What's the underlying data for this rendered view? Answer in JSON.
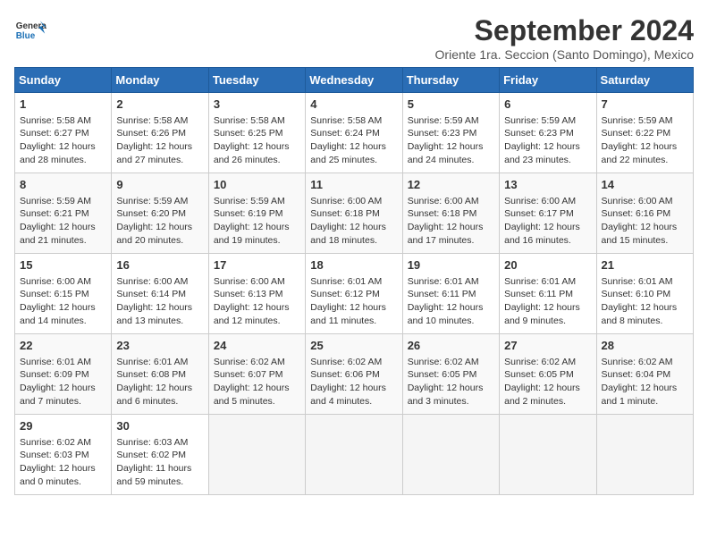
{
  "header": {
    "logo_general": "General",
    "logo_blue": "Blue",
    "month_title": "September 2024",
    "subtitle": "Oriente 1ra. Seccion (Santo Domingo), Mexico"
  },
  "weekdays": [
    "Sunday",
    "Monday",
    "Tuesday",
    "Wednesday",
    "Thursday",
    "Friday",
    "Saturday"
  ],
  "weeks": [
    [
      {
        "day": 1,
        "sunrise": "5:58 AM",
        "sunset": "6:27 PM",
        "daylight": "12 hours and 28 minutes."
      },
      {
        "day": 2,
        "sunrise": "5:58 AM",
        "sunset": "6:26 PM",
        "daylight": "12 hours and 27 minutes."
      },
      {
        "day": 3,
        "sunrise": "5:58 AM",
        "sunset": "6:25 PM",
        "daylight": "12 hours and 26 minutes."
      },
      {
        "day": 4,
        "sunrise": "5:58 AM",
        "sunset": "6:24 PM",
        "daylight": "12 hours and 25 minutes."
      },
      {
        "day": 5,
        "sunrise": "5:59 AM",
        "sunset": "6:23 PM",
        "daylight": "12 hours and 24 minutes."
      },
      {
        "day": 6,
        "sunrise": "5:59 AM",
        "sunset": "6:23 PM",
        "daylight": "12 hours and 23 minutes."
      },
      {
        "day": 7,
        "sunrise": "5:59 AM",
        "sunset": "6:22 PM",
        "daylight": "12 hours and 22 minutes."
      }
    ],
    [
      {
        "day": 8,
        "sunrise": "5:59 AM",
        "sunset": "6:21 PM",
        "daylight": "12 hours and 21 minutes."
      },
      {
        "day": 9,
        "sunrise": "5:59 AM",
        "sunset": "6:20 PM",
        "daylight": "12 hours and 20 minutes."
      },
      {
        "day": 10,
        "sunrise": "5:59 AM",
        "sunset": "6:19 PM",
        "daylight": "12 hours and 19 minutes."
      },
      {
        "day": 11,
        "sunrise": "6:00 AM",
        "sunset": "6:18 PM",
        "daylight": "12 hours and 18 minutes."
      },
      {
        "day": 12,
        "sunrise": "6:00 AM",
        "sunset": "6:18 PM",
        "daylight": "12 hours and 17 minutes."
      },
      {
        "day": 13,
        "sunrise": "6:00 AM",
        "sunset": "6:17 PM",
        "daylight": "12 hours and 16 minutes."
      },
      {
        "day": 14,
        "sunrise": "6:00 AM",
        "sunset": "6:16 PM",
        "daylight": "12 hours and 15 minutes."
      }
    ],
    [
      {
        "day": 15,
        "sunrise": "6:00 AM",
        "sunset": "6:15 PM",
        "daylight": "12 hours and 14 minutes."
      },
      {
        "day": 16,
        "sunrise": "6:00 AM",
        "sunset": "6:14 PM",
        "daylight": "12 hours and 13 minutes."
      },
      {
        "day": 17,
        "sunrise": "6:00 AM",
        "sunset": "6:13 PM",
        "daylight": "12 hours and 12 minutes."
      },
      {
        "day": 18,
        "sunrise": "6:01 AM",
        "sunset": "6:12 PM",
        "daylight": "12 hours and 11 minutes."
      },
      {
        "day": 19,
        "sunrise": "6:01 AM",
        "sunset": "6:11 PM",
        "daylight": "12 hours and 10 minutes."
      },
      {
        "day": 20,
        "sunrise": "6:01 AM",
        "sunset": "6:11 PM",
        "daylight": "12 hours and 9 minutes."
      },
      {
        "day": 21,
        "sunrise": "6:01 AM",
        "sunset": "6:10 PM",
        "daylight": "12 hours and 8 minutes."
      }
    ],
    [
      {
        "day": 22,
        "sunrise": "6:01 AM",
        "sunset": "6:09 PM",
        "daylight": "12 hours and 7 minutes."
      },
      {
        "day": 23,
        "sunrise": "6:01 AM",
        "sunset": "6:08 PM",
        "daylight": "12 hours and 6 minutes."
      },
      {
        "day": 24,
        "sunrise": "6:02 AM",
        "sunset": "6:07 PM",
        "daylight": "12 hours and 5 minutes."
      },
      {
        "day": 25,
        "sunrise": "6:02 AM",
        "sunset": "6:06 PM",
        "daylight": "12 hours and 4 minutes."
      },
      {
        "day": 26,
        "sunrise": "6:02 AM",
        "sunset": "6:05 PM",
        "daylight": "12 hours and 3 minutes."
      },
      {
        "day": 27,
        "sunrise": "6:02 AM",
        "sunset": "6:05 PM",
        "daylight": "12 hours and 2 minutes."
      },
      {
        "day": 28,
        "sunrise": "6:02 AM",
        "sunset": "6:04 PM",
        "daylight": "12 hours and 1 minute."
      }
    ],
    [
      {
        "day": 29,
        "sunrise": "6:02 AM",
        "sunset": "6:03 PM",
        "daylight": "12 hours and 0 minutes."
      },
      {
        "day": 30,
        "sunrise": "6:03 AM",
        "sunset": "6:02 PM",
        "daylight": "11 hours and 59 minutes."
      },
      null,
      null,
      null,
      null,
      null
    ]
  ]
}
